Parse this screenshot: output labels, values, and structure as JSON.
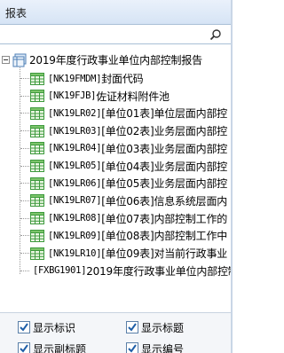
{
  "header": {
    "title": "报表"
  },
  "search": {
    "placeholder": "",
    "value": ""
  },
  "tree": {
    "root": {
      "label": "2019年度行政事业单位内部控制报告"
    },
    "children": [
      {
        "code": "[NK19FMDM]",
        "label": "封面代码"
      },
      {
        "code": "[NK19FJB]",
        "label": "佐证材料附件池"
      },
      {
        "code": "[NK19LR02]",
        "label": "[单位01表]单位层面内部控"
      },
      {
        "code": "[NK19LR03]",
        "label": "[单位02表]业务层面内部控"
      },
      {
        "code": "[NK19LR04]",
        "label": "[单位03表]业务层面内部控"
      },
      {
        "code": "[NK19LR05]",
        "label": "[单位04表]业务层面内部控"
      },
      {
        "code": "[NK19LR06]",
        "label": "[单位05表]业务层面内部控"
      },
      {
        "code": "[NK19LR07]",
        "label": "[单位06表]信息系统层面内"
      },
      {
        "code": "[NK19LR08]",
        "label": "[单位07表]内部控制工作的"
      },
      {
        "code": "[NK19LR09]",
        "label": "[单位08表]内部控制工作中"
      },
      {
        "code": "[NK19LR10]",
        "label": "[单位09表]对当前行政事业"
      }
    ],
    "last": {
      "code": "[FXBG1901]",
      "label": "2019年度行政事业单位内部控制"
    }
  },
  "options": {
    "show_id": {
      "label": "显示标识",
      "checked": true
    },
    "show_title": {
      "label": "显示标题",
      "checked": true
    },
    "show_subtitle": {
      "label": "显示副标题",
      "checked": true
    },
    "show_number": {
      "label": "显示编号",
      "checked": true
    }
  },
  "colors": {
    "header_bg": "#d6e4f5",
    "table_icon_green": "#3e9a3e",
    "check_blue": "#1f5fa8"
  }
}
